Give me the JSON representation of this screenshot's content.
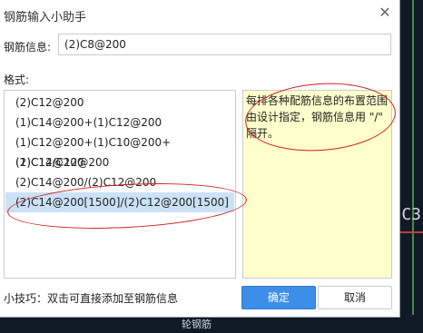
{
  "dialog": {
    "title": "钢筋输入小助手",
    "close_glyph": "✕"
  },
  "info": {
    "label": "钢筋信息:",
    "value": "(2)C8@200"
  },
  "format": {
    "label": "格式:"
  },
  "list": {
    "items": [
      {
        "label": "(2)C12@200"
      },
      {
        "label": "(1)C14@200+(1)C12@200"
      },
      {
        "label": "(1)C12@200+(1)C10@200+(1)C12@200"
      },
      {
        "label": "(2)C14/C12@200"
      },
      {
        "label": "(2)C14@200/(2)C12@200"
      },
      {
        "label": "(2)C14@200[1500]/(2)C12@200[1500]"
      }
    ],
    "selected_index": 5
  },
  "hint": {
    "text": "每排各种配筋信息的布置范围由设计指定，钢筋信息用 \"/\" 隔开。"
  },
  "tip": {
    "text": "小技巧：双击可直接添加至钢筋信息"
  },
  "buttons": {
    "ok": "确定",
    "cancel": "取消"
  },
  "background": {
    "cad_label": "C3",
    "bottom_text": "轮钢筋"
  },
  "colors": {
    "accent": "#3d8ee8",
    "selected": "#cbe1f6",
    "hint_bg": "#ffffcc",
    "annotation": "#d21f1f"
  }
}
